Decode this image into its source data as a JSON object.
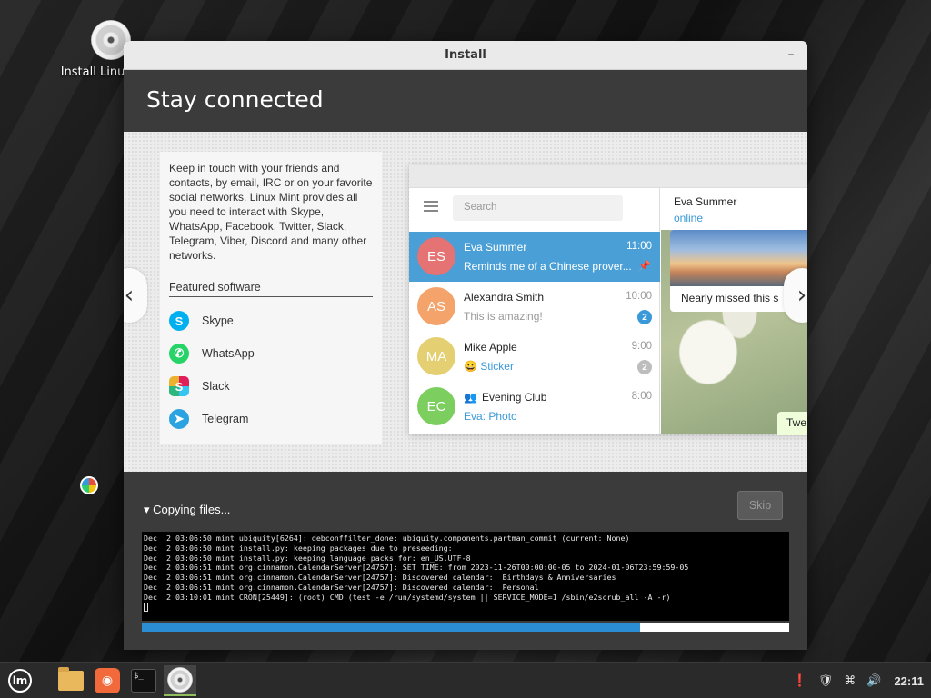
{
  "desktop": {
    "icon_label": "Install Linux Mint"
  },
  "window": {
    "title": "Install",
    "header_title": "Stay connected"
  },
  "slide": {
    "description": "Keep in touch with your friends and contacts, by email, IRC or on your favorite social networks. Linux Mint provides all you need to interact with Skype, WhatsApp, Facebook, Twitter, Slack, Telegram, Viber, Discord and many other networks.",
    "featured_title": "Featured software",
    "software": [
      {
        "label": "Skype",
        "icon": "skype-icon",
        "glyph": "S"
      },
      {
        "label": "WhatsApp",
        "icon": "whatsapp-icon",
        "glyph": "✆"
      },
      {
        "label": "Slack",
        "icon": "slack-icon",
        "glyph": "S"
      },
      {
        "label": "Telegram",
        "icon": "telegram-icon",
        "glyph": "➤"
      }
    ],
    "telegram": {
      "search_placeholder": "Search",
      "chats": [
        {
          "initials": "ES",
          "name": "Eva Summer",
          "time": "11:00",
          "msg": "Reminds me of a Chinese prover...",
          "color": "#e57373",
          "active": true
        },
        {
          "initials": "AS",
          "name": "Alexandra Smith",
          "time": "10:00",
          "msg": "This is amazing!",
          "color": "#f4a36b",
          "badge": "2",
          "badge_color": "#3a9ad9"
        },
        {
          "initials": "MA",
          "name": "Mike Apple",
          "time": "9:00",
          "msg": "😀 Sticker",
          "color": "#e4cf73",
          "badge": "2",
          "badge_color": "#bdbdbd"
        },
        {
          "initials": "EC",
          "name": "Evening Club",
          "time": "8:00",
          "msg": "Eva: Photo",
          "color": "#7ccf5e"
        }
      ],
      "conversation": {
        "name": "Eva Summer",
        "status": "online",
        "photo_caption": "Nearly missed this s",
        "partial_bubble": "Twe"
      }
    }
  },
  "progress": {
    "status_label": "Copying files...",
    "skip_label": "Skip",
    "percent": 77,
    "log_lines": [
      "Dec  2 03:06:50 mint ubiquity[6264]: debconffilter_done: ubiquity.components.partman_commit (current: None)",
      "Dec  2 03:06:50 mint install.py: keeping packages due to preseeding:",
      "Dec  2 03:06:50 mint install.py: keeping language packs for: en_US.UTF-8",
      "Dec  2 03:06:51 mint org.cinnamon.CalendarServer[24757]: SET TIME: from 2023-11-26T00:00:00-05 to 2024-01-06T23:59:59-05",
      "Dec  2 03:06:51 mint org.cinnamon.CalendarServer[24757]: Discovered calendar:  Birthdays & Anniversaries",
      "Dec  2 03:06:51 mint org.cinnamon.CalendarServer[24757]: Discovered calendar:  Personal",
      "Dec  2 03:10:01 mint CRON[25449]: (root) CMD (test -e /run/systemd/system || SERVICE_MODE=1 /sbin/e2scrub_all -A -r)"
    ]
  },
  "panel": {
    "clock": "22:11"
  }
}
